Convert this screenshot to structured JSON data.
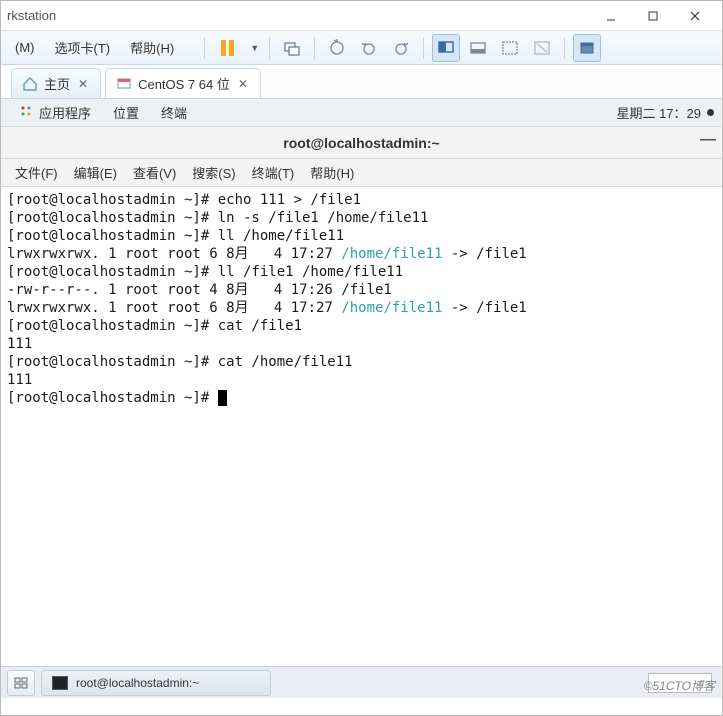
{
  "window": {
    "title_fragment": "rkstation"
  },
  "menubar": {
    "items": [
      {
        "label": "(M)"
      },
      {
        "label": "选项卡(T)"
      },
      {
        "label": "帮助(H)"
      }
    ]
  },
  "tabs": {
    "home": {
      "label": "主页"
    },
    "vm": {
      "label": "CentOS 7 64 位"
    }
  },
  "guest_menubar": {
    "apps": "应用程序",
    "places": "位置",
    "terminal": "终端",
    "clock": "星期二 17：29"
  },
  "term_window_title": "root@localhostadmin:~",
  "term_menu": {
    "file": "文件(F)",
    "edit": "编辑(E)",
    "view": "查看(V)",
    "search": "搜索(S)",
    "terminal": "终端(T)",
    "help": "帮助(H)"
  },
  "terminal_lines": [
    {
      "plain": "[root@localhostadmin ~]# echo 111 > /file1"
    },
    {
      "plain": "[root@localhostadmin ~]# ln -s /file1 /home/file11"
    },
    {
      "plain": "[root@localhostadmin ~]# ll /home/file11"
    },
    {
      "pre": "lrwxrwxrwx. 1 root root 6 8月   4 17:27 ",
      "link": "/home/file11",
      "post": " -> /file1"
    },
    {
      "plain": "[root@localhostadmin ~]# ll /file1 /home/file11"
    },
    {
      "plain": "-rw-r--r--. 1 root root 4 8月   4 17:26 /file1"
    },
    {
      "pre": "lrwxrwxrwx. 1 root root 6 8月   4 17:27 ",
      "link": "/home/file11",
      "post": " -> /file1"
    },
    {
      "plain": "[root@localhostadmin ~]# cat /file1"
    },
    {
      "plain": "111"
    },
    {
      "plain": "[root@localhostadmin ~]# cat /home/file11"
    },
    {
      "plain": "111"
    },
    {
      "prompt_cursor": "[root@localhostadmin ~]# "
    }
  ],
  "taskbar": {
    "task_label": "root@localhostadmin:~"
  },
  "watermark": "©51CTO博客"
}
